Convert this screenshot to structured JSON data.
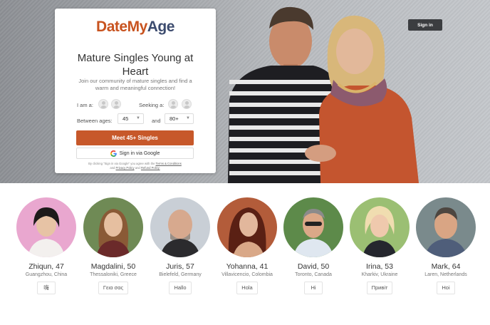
{
  "header": {
    "signin_label": "Sign in"
  },
  "card": {
    "logo": {
      "part1": "Date",
      "part2": "My",
      "part3": "Age"
    },
    "headline_line1": "Mature Singles Young at",
    "headline_line2": "Heart",
    "subline": "Join our community of mature singles and find a warm and meaningful connection!",
    "iam_label": "I am a:",
    "seeking_label": "Seeking a:",
    "between_label": "Between ages:",
    "and_label": "and",
    "age_min": "45",
    "age_max": "80+",
    "cta_label": "Meet 45+ Singles",
    "google_label": "Sign in via Google",
    "legal": {
      "prefix": "By clicking \"Sign in via Google\" you agree with the",
      "terms": "Terms & Conditions",
      "and1": "and",
      "privacy": "Privacy Policy",
      "and2": "and",
      "refund": "Refund Policy."
    }
  },
  "profiles": [
    {
      "name": "Zhiqun, 47",
      "location": "Guangzhou, China",
      "greeting": "嗨"
    },
    {
      "name": "Magdalini, 50",
      "location": "Thessaloniki, Greece",
      "greeting": "Γεια σας"
    },
    {
      "name": "Juris, 57",
      "location": "Bielefeld, Germany",
      "greeting": "Hallo"
    },
    {
      "name": "Yohanna, 41",
      "location": "Villavicencio, Colombia",
      "greeting": "Hola"
    },
    {
      "name": "David, 50",
      "location": "Toronto, Canada",
      "greeting": "Hi"
    },
    {
      "name": "Irina, 53",
      "location": "Kharkiv, Ukraine",
      "greeting": "Привіт"
    },
    {
      "name": "Mark, 64",
      "location": "Laren, Netherlands",
      "greeting": "Hoi"
    }
  ],
  "colors": {
    "brand_orange": "#c7582a",
    "brand_navy": "#3c4b6e",
    "dark_button": "#3b3d40"
  }
}
